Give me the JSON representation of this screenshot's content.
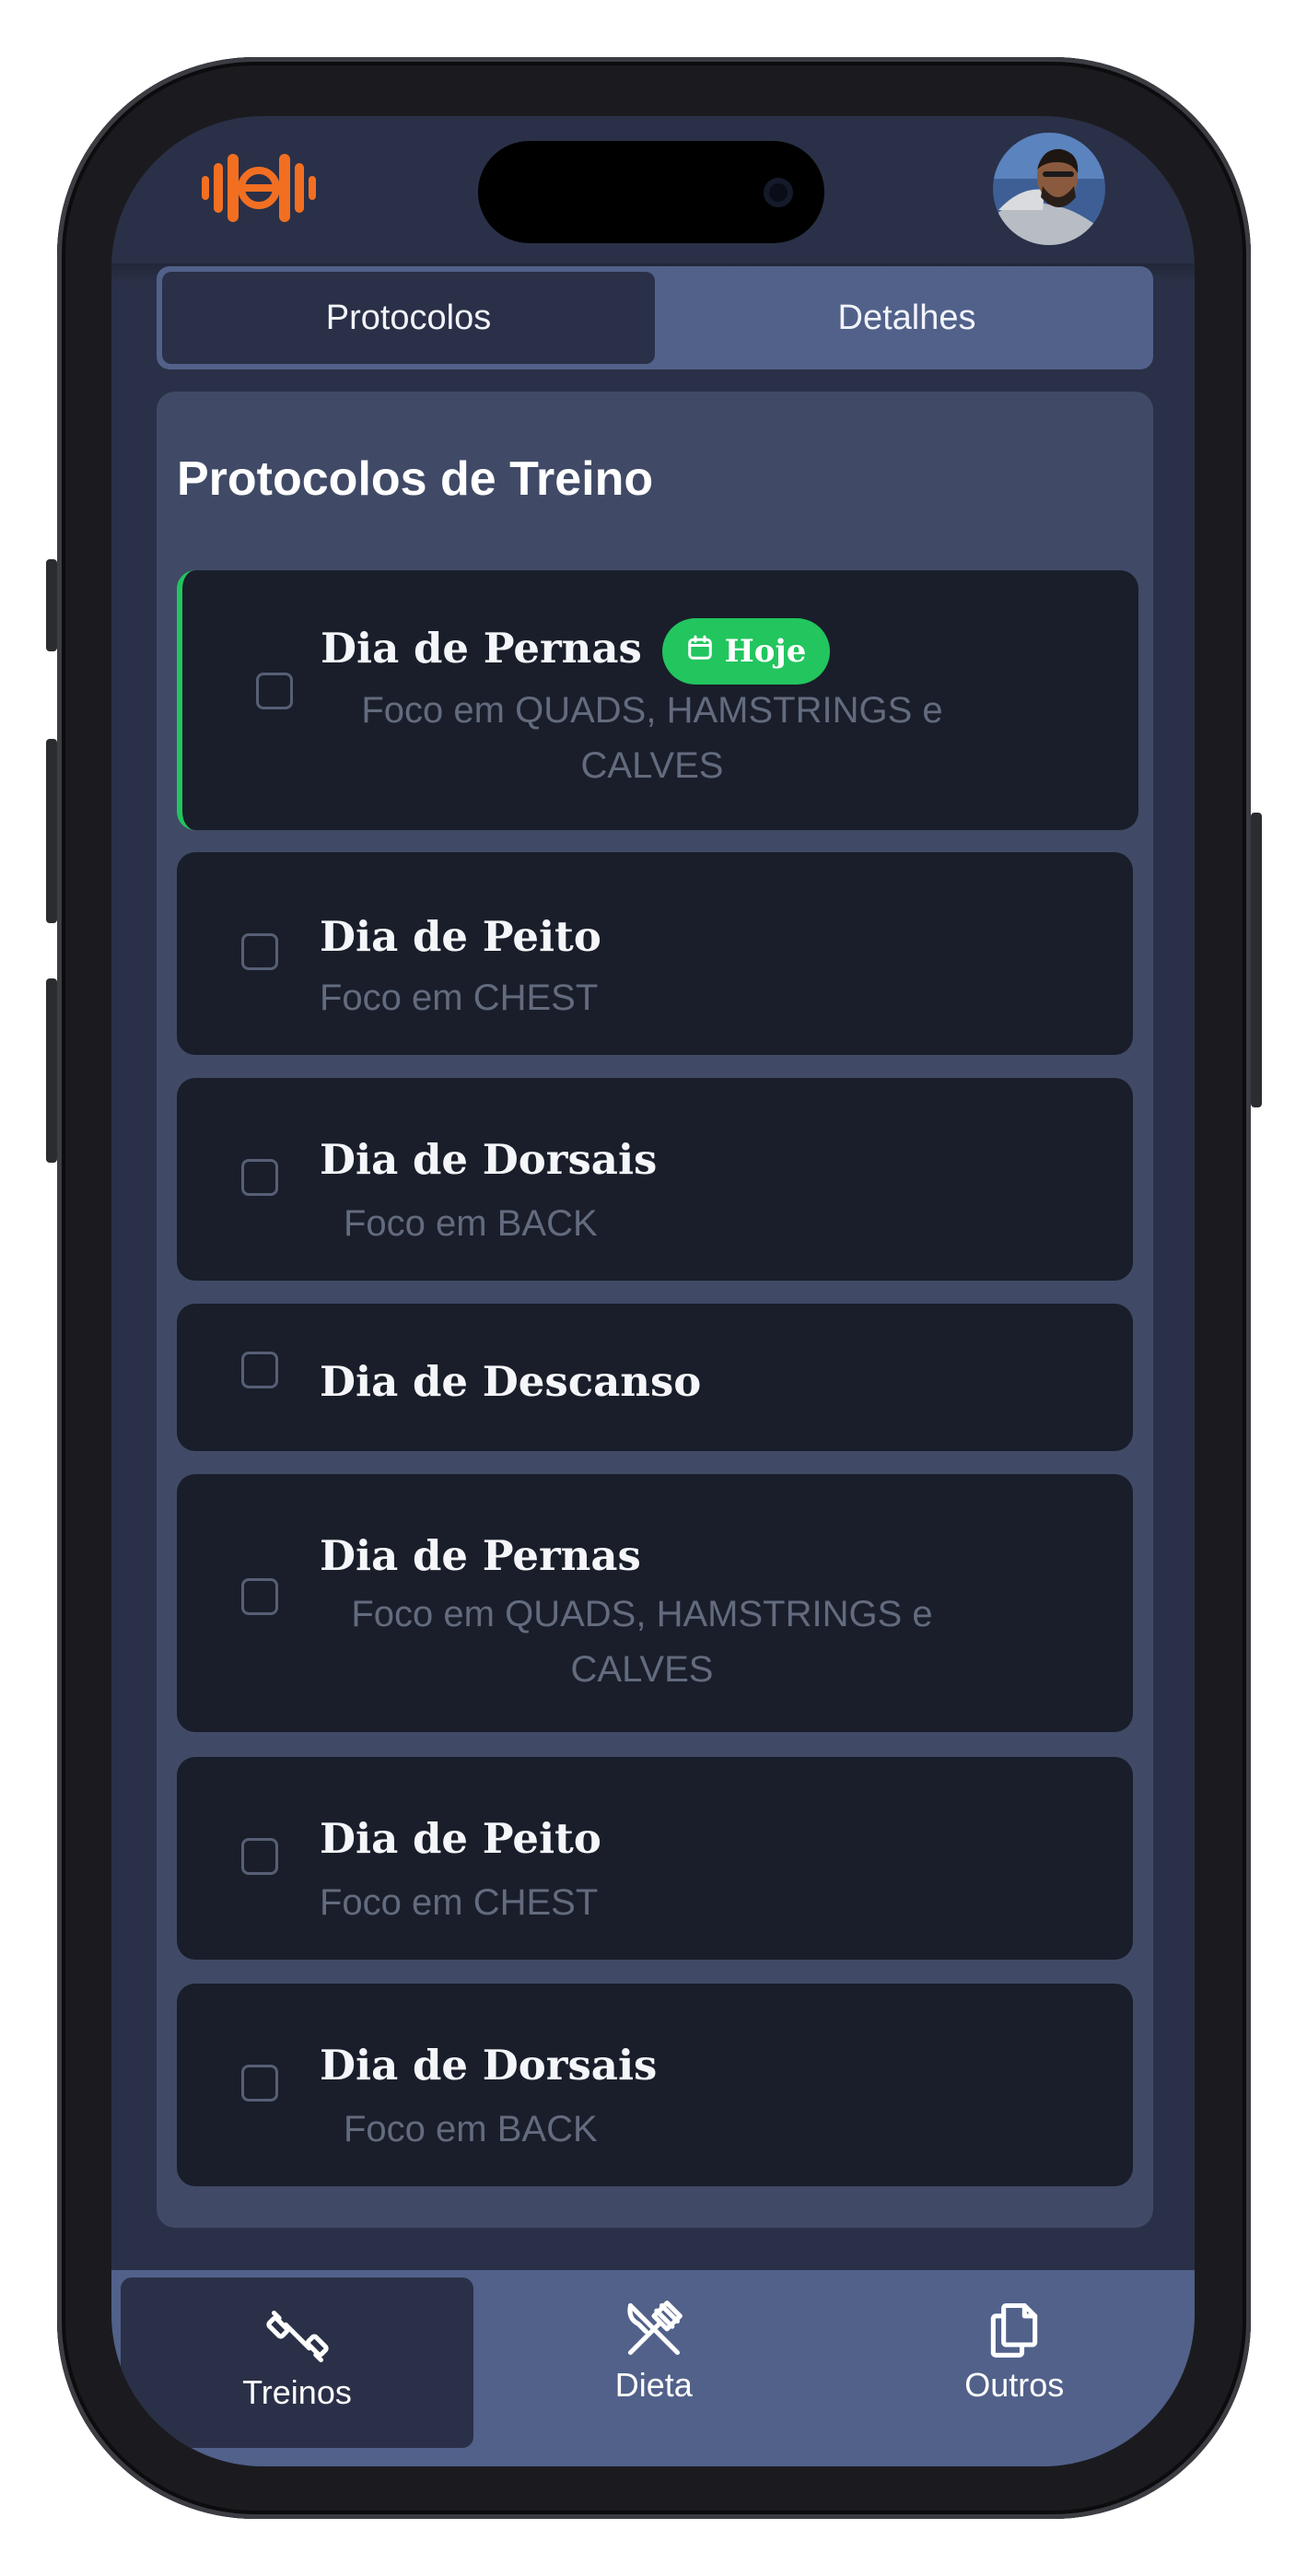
{
  "app": {
    "accent": "#f26f22",
    "success": "#22c55e"
  },
  "header": {
    "logo_icon": "barbell-logo-icon",
    "avatar_icon": "user-avatar"
  },
  "tabs": [
    {
      "label": "Protocolos",
      "active": true
    },
    {
      "label": "Detalhes",
      "active": false
    }
  ],
  "panel": {
    "title": "Protocolos de Treino"
  },
  "workouts": [
    {
      "title": "Dia de Pernas",
      "subtitle": "Foco em QUADS, HAMSTRINGS e CALVES",
      "today": true,
      "badge": "Hoje",
      "checked": false
    },
    {
      "title": "Dia de Peito",
      "subtitle": "Foco em CHEST",
      "today": false,
      "checked": false
    },
    {
      "title": "Dia de Dorsais",
      "subtitle": "Foco em BACK",
      "today": false,
      "checked": false
    },
    {
      "title": "Dia de Descanso",
      "subtitle": "",
      "today": false,
      "checked": false
    },
    {
      "title": "Dia de Pernas",
      "subtitle": "Foco em QUADS, HAMSTRINGS e CALVES",
      "today": false,
      "checked": false
    },
    {
      "title": "Dia de Peito",
      "subtitle": "Foco em CHEST",
      "today": false,
      "checked": false
    },
    {
      "title": "Dia de Dorsais",
      "subtitle": "Foco em BACK",
      "today": false,
      "checked": false
    }
  ],
  "nav": [
    {
      "label": "Treinos",
      "icon": "dumbbell-icon",
      "active": true
    },
    {
      "label": "Dieta",
      "icon": "utensils-icon",
      "active": false
    },
    {
      "label": "Outros",
      "icon": "copy-icon",
      "active": false
    }
  ]
}
